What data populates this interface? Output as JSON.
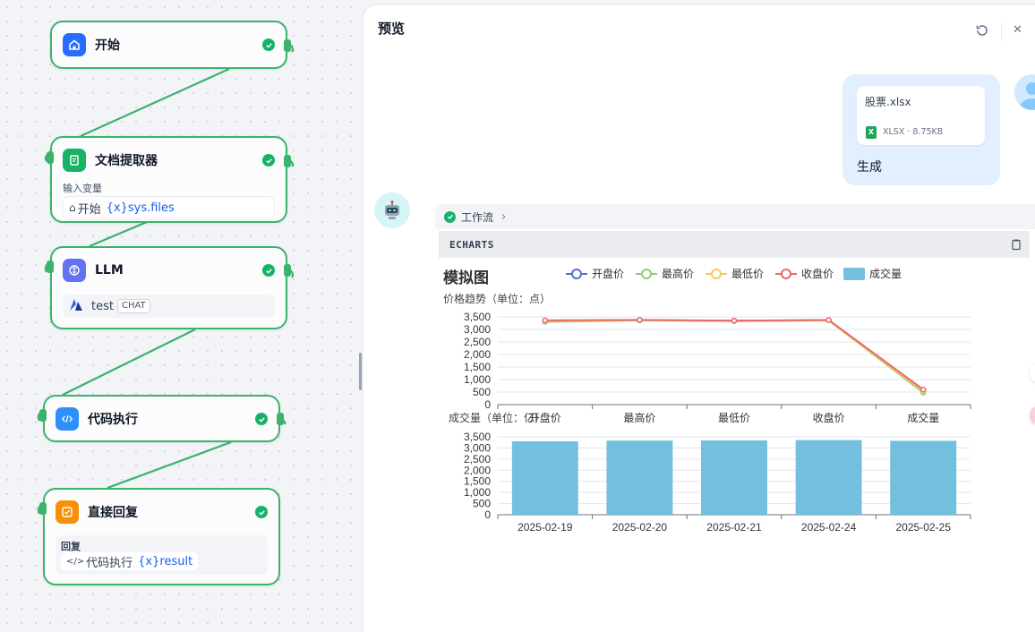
{
  "nodes": {
    "start": {
      "title": "开始"
    },
    "doc_extractor": {
      "title": "文档提取器",
      "sub_label": "输入变量",
      "var_source": "开始",
      "var_name": "{x}sys.files"
    },
    "llm": {
      "title": "LLM",
      "model_name": "test",
      "model_tag": "CHAT"
    },
    "code": {
      "title": "代码执行"
    },
    "answer": {
      "title": "直接回复",
      "sub_label": "回复",
      "var_source": "代码执行",
      "var_name": "{x}result"
    }
  },
  "panel": {
    "title": "预览",
    "user_message": {
      "file_name": "股票.xlsx",
      "file_meta": "XLSX · 8.75KB",
      "text": "生成"
    },
    "workflow_label": "工作流",
    "code_block_label": "ECHARTS"
  },
  "colors": {
    "node_border": "#3bb36b",
    "success": "#17b26a",
    "accent": "#155eef",
    "open": "#5470c6",
    "high": "#91cc75",
    "low": "#fac858",
    "close": "#ee6666",
    "volume": "#73c0de"
  },
  "chart_data": [
    {
      "type": "line",
      "title": "模拟图",
      "subtitle": "价格趋势（单位：点）",
      "legend": [
        "开盘价",
        "最高价",
        "最低价",
        "收盘价",
        "成交量"
      ],
      "legend_position": "top-center",
      "categories": [
        "开盘价",
        "最高价",
        "最低价",
        "收盘价",
        "成交量"
      ],
      "ylim": [
        0,
        3500
      ],
      "yticks": [
        "0",
        "500",
        "1,000",
        "1,500",
        "2,000",
        "2,500",
        "3,000",
        "3,500"
      ],
      "grid": true,
      "series": [
        {
          "name": "开盘价",
          "values": [
            3330,
            3370,
            3345,
            3370,
            520
          ]
        },
        {
          "name": "最高价",
          "values": [
            3300,
            3360,
            3330,
            3360,
            480
          ]
        },
        {
          "name": "最低价",
          "values": [
            3340,
            3375,
            3340,
            3365,
            540
          ]
        },
        {
          "name": "收盘价",
          "values": [
            3360,
            3380,
            3350,
            3375,
            600
          ]
        }
      ]
    },
    {
      "type": "bar",
      "ylabel": "成交量（单位：亿）",
      "categories": [
        "2025-02-19",
        "2025-02-20",
        "2025-02-21",
        "2025-02-24",
        "2025-02-25"
      ],
      "ylim": [
        0,
        3500
      ],
      "yticks": [
        "0",
        "500",
        "1,000",
        "1,500",
        "2,000",
        "2,500",
        "3,000",
        "3,500"
      ],
      "grid": true,
      "series": [
        {
          "name": "成交量",
          "values": [
            3300,
            3330,
            3340,
            3355,
            3320
          ]
        }
      ]
    }
  ]
}
